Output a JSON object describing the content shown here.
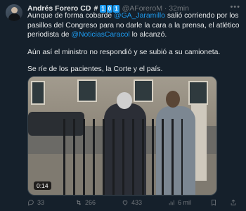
{
  "author": {
    "name": "Andrés Forero CD",
    "badges": [
      "#",
      "1",
      "0",
      "1"
    ],
    "handle": "@AForeroM · 32min"
  },
  "tweet": {
    "p1": {
      "pre": "Aunque de forma cobarde ",
      "mention1": "@GA_Jaramillo",
      "mid": " salió corriendo por los pasillos del Congreso para no darle la cara a la prensa, el atlético periodista de ",
      "mention2": "@NoticiasCaracol",
      "post": " lo alcanzó."
    },
    "p2": "Aún así el ministro no respondió y se subió a su camioneta.",
    "p3": "Se ríe de los pacientes, la Corte y el país."
  },
  "media": {
    "timestamp": "0:14"
  },
  "actions": {
    "replies": "33",
    "retweets": "266",
    "likes": "433",
    "views": "6 mil"
  },
  "colors": {
    "background": "#15202b",
    "accent": "#1d9bf0",
    "muted": "#71767b"
  }
}
